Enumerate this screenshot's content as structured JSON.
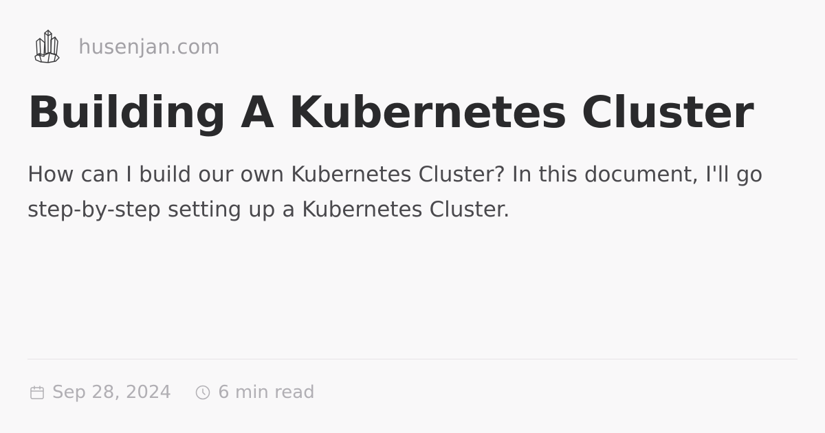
{
  "site": {
    "logo_icon": "crystal-cluster-icon",
    "name": "husenjan.com"
  },
  "post": {
    "title": "Building A Kubernetes Cluster",
    "description": "How can I build our own Kubernetes Cluster? In this document, I'll go step-by-step setting up a Kubernetes Cluster."
  },
  "meta": {
    "date_icon": "calendar-icon",
    "date": "Sep 28, 2024",
    "read_time_icon": "clock-icon",
    "read_time": "6 min read"
  },
  "colors": {
    "background": "#f9f8f9",
    "title": "#2a2a2c",
    "body_text": "#4a494d",
    "muted_text": "#a3a1a6",
    "divider": "#e6e4e7"
  }
}
